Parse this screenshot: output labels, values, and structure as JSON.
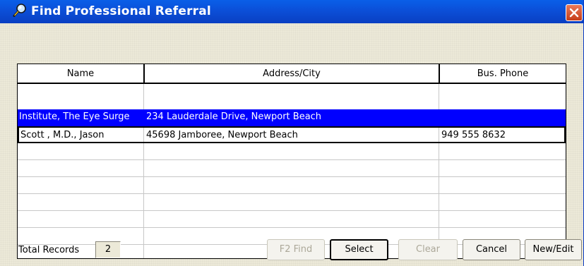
{
  "window": {
    "title": "Find Professional Referral",
    "title_icon": "search-magnifier-icon",
    "close_icon": "close-icon"
  },
  "grid": {
    "columns": [
      "Name",
      "Address/City",
      "Bus. Phone"
    ],
    "rows": [
      {
        "name": "Institute, The Eye Surge",
        "address": "234 Lauderdale Drive, Newport Beach",
        "phone": "",
        "selected": true
      },
      {
        "name": "Scott , M.D., Jason",
        "address": "45698 Jamboree, Newport Beach",
        "phone": "949 555 8632",
        "selected": false
      }
    ],
    "empty_rows": 7
  },
  "footer": {
    "total_label": "Total Records",
    "total_value": "2",
    "buttons": {
      "find": {
        "label": "F2 Find",
        "enabled": false
      },
      "select": {
        "label": "Select",
        "enabled": true,
        "default": true
      },
      "clear": {
        "label": "Clear",
        "enabled": false
      },
      "cancel": {
        "label": "Cancel",
        "enabled": true
      },
      "new_edit": {
        "label": "New/Edit",
        "enabled": true
      }
    }
  },
  "colors": {
    "titlebar": "#0a4fd8",
    "selection": "#0000ff",
    "dialog_bg": "#ece9d8"
  }
}
